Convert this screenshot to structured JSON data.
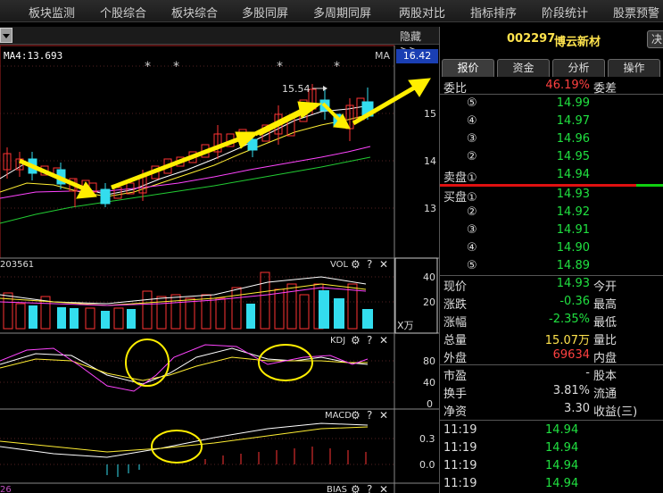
{
  "menu": [
    "板块监测",
    "个股综合",
    "板块综合",
    "多股同屏",
    "多周期同屏",
    "两股对比",
    "指标排序",
    "阶段统计",
    "股票预警"
  ],
  "chart": {
    "hide_label": "隐藏>>",
    "ma_label": "MA4:13.693",
    "ma_right": "MA",
    "last_price_box": "16.42",
    "high_marker": "15.54",
    "price_ticks": [
      "15",
      "14",
      "13"
    ],
    "vol_value": "203561",
    "vol_title": "VOL",
    "vol_ticks": [
      "40",
      "20"
    ],
    "vol_unit": "X万",
    "kdj_title": "KDJ",
    "kdj_ticks": [
      "80",
      "40",
      "0"
    ],
    "macd_title": "MACD",
    "macd_ticks": [
      "0.3",
      "0.0"
    ],
    "bias_title": "BIAS",
    "bias_left": "26",
    "gear_glyph": "⚙",
    "help_glyph": "?",
    "close_glyph": "✕",
    "star_glyph": "*"
  },
  "stock": {
    "code": "002297",
    "name": "博云新材",
    "decide": "决"
  },
  "tabs": [
    "报价",
    "资金",
    "分析",
    "操作"
  ],
  "weibi": {
    "label": "委比",
    "value": "46.19%",
    "right": "委差"
  },
  "sell": [
    {
      "n": "⑤",
      "p": "14.99"
    },
    {
      "n": "④",
      "p": "14.97"
    },
    {
      "n": "③",
      "p": "14.96"
    },
    {
      "n": "②",
      "p": "14.95"
    },
    {
      "n": "卖盘①",
      "p": "14.94"
    }
  ],
  "buy": [
    {
      "n": "买盘①",
      "p": "14.93"
    },
    {
      "n": "②",
      "p": "14.92"
    },
    {
      "n": "③",
      "p": "14.91"
    },
    {
      "n": "④",
      "p": "14.90"
    },
    {
      "n": "⑤",
      "p": "14.89"
    }
  ],
  "quote": [
    {
      "l": "现价",
      "v": "14.93",
      "r": "今开",
      "c": "g"
    },
    {
      "l": "涨跌",
      "v": "-0.36",
      "r": "最高",
      "c": "g"
    },
    {
      "l": "涨幅",
      "v": "-2.35%",
      "r": "最低",
      "c": "g"
    },
    {
      "l": "总量",
      "v": "15.07万",
      "r": "量比",
      "c": "y"
    },
    {
      "l": "外盘",
      "v": "69634",
      "r": "内盘",
      "c": "rd"
    },
    {
      "l": "市盈",
      "v": "-",
      "r": "股本",
      "c": "w"
    },
    {
      "l": "换手",
      "v": "3.81%",
      "r": "流通",
      "c": "w"
    },
    {
      "l": "净资",
      "v": "3.30",
      "r": "收益(三)",
      "c": "w"
    }
  ],
  "trades": [
    {
      "t": "11:19",
      "p": "14.94"
    },
    {
      "t": "11:19",
      "p": "14.94"
    },
    {
      "t": "11:19",
      "p": "14.94"
    },
    {
      "t": "11:19",
      "p": "14.94"
    }
  ]
}
